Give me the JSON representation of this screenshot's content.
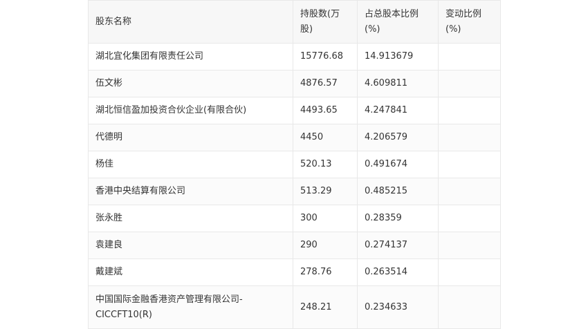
{
  "table": {
    "headers": [
      "股东名称",
      "持股数(万股)",
      "占总股本比例(%)",
      "变动比例(%)"
    ],
    "rows": [
      [
        "湖北宜化集团有限责任公司",
        "15776.68",
        "14.913679",
        ""
      ],
      [
        "伍文彬",
        "4876.57",
        "4.609811",
        ""
      ],
      [
        "湖北恒信盈加投资合伙企业(有限合伙)",
        "4493.65",
        "4.247841",
        ""
      ],
      [
        "代德明",
        "4450",
        "4.206579",
        ""
      ],
      [
        "杨佳",
        "520.13",
        "0.491674",
        ""
      ],
      [
        "香港中央结算有限公司",
        "513.29",
        "0.485215",
        ""
      ],
      [
        "张永胜",
        "300",
        "0.28359",
        ""
      ],
      [
        "袁建良",
        "290",
        "0.274137",
        ""
      ],
      [
        "戴建斌",
        "278.76",
        "0.263514",
        ""
      ],
      [
        "中国国际金融香港资产管理有限公司-CICCFT10(R)",
        "248.21",
        "0.234633",
        ""
      ]
    ]
  }
}
